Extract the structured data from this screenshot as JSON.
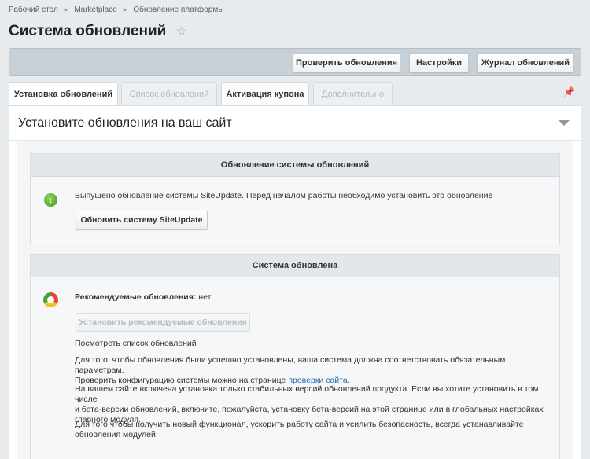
{
  "breadcrumb": [
    "Рабочий стол",
    "Marketplace",
    "Обновление платформы"
  ],
  "page": {
    "title": "Система обновлений"
  },
  "toolbar": {
    "check_updates": "Проверить обновления",
    "settings": "Настройки",
    "log": "Журнал обновлений"
  },
  "tabs": [
    {
      "label": "Установка обновлений",
      "state": "active"
    },
    {
      "label": "Список обновлений",
      "state": "disabled"
    },
    {
      "label": "Активация купона",
      "state": "normal"
    },
    {
      "label": "Дополнительно",
      "state": "disabled"
    }
  ],
  "section": {
    "title": "Установите обновления на ваш сайт"
  },
  "update_card": {
    "header": "Обновление системы обновлений",
    "message": "Выпущено обновление системы SiteUpdate. Перед началом работы необходимо установить это обновление",
    "button": "Обновить систему SiteUpdate"
  },
  "status_card": {
    "header": "Система обновлена",
    "recommended_label": "Рекомендуемые обновления:",
    "recommended_value": "нет",
    "install_button": "Установить рекомендуемые обновления",
    "list_link": "Посмотреть список обновлений",
    "p1_line1": "Для того, чтобы обновления были успешно установлены, ваша система должна соответствовать обязательным параметрам.",
    "p1_line2_prefix": "Проверить конфигурацию системы можно на странице",
    "p1_link": "проверки сайта",
    "p1_suffix": ".",
    "p2_line1": "На вашем сайте включена установка только стабильных версий обновлений продукта. Если вы хотите установить в том числе",
    "p2_line2": "и бета-версии обновлений, включите, пожалуйста, установку бета-версий на этой странице или в глобальных настройках",
    "p2_line3": "главного модуля.",
    "p3_line1": "Для того чтобы получить новый функционал, ускорить работу сайта и усилить безопасность, всегда устанавливайте",
    "p3_line2": "обновления модулей."
  },
  "colors": {
    "link": "#2067b0",
    "toolbar_bg": "#c8d0d7",
    "ok_green": "#3b9a1f"
  }
}
